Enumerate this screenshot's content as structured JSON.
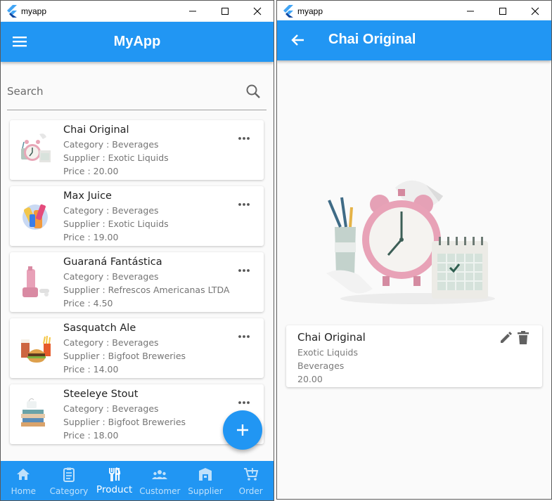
{
  "left_window": {
    "title": "myapp",
    "appbar_title": "MyApp",
    "search_placeholder": "Search",
    "products": [
      {
        "name": "Chai Original",
        "category": "Category : Beverages",
        "supplier": "Supplier : Exotic Liquids",
        "price": "Price : 20.00",
        "image": "alarm-clock-illustration"
      },
      {
        "name": "Max Juice",
        "category": "Category : Beverages",
        "supplier": "Supplier : Exotic Liquids",
        "price": "Price : 19.00",
        "image": "juice-bottles-illustration"
      },
      {
        "name": "Guaraná Fantástica",
        "category": "Category : Beverages",
        "supplier": "Supplier : Refrescos Americanas LTDA",
        "price": "Price : 4.50",
        "image": "pink-bottles-illustration"
      },
      {
        "name": "Sasquatch Ale",
        "category": "Category : Beverages",
        "supplier": "Supplier : Bigfoot Breweries",
        "price": "Price : 14.00",
        "image": "burger-drinks-illustration"
      },
      {
        "name": "Steeleye Stout",
        "category": "Category : Beverages",
        "supplier": "Supplier : Bigfoot Breweries",
        "price": "Price : 18.00",
        "image": "books-cup-illustration"
      }
    ],
    "bottom_nav": [
      {
        "label": "Home",
        "icon": "home-icon",
        "active": false
      },
      {
        "label": "Category",
        "icon": "clipboard-icon",
        "active": false
      },
      {
        "label": "Product",
        "icon": "cutlery-icon",
        "active": true
      },
      {
        "label": "Customer",
        "icon": "people-icon",
        "active": false
      },
      {
        "label": "Supplier",
        "icon": "store-icon",
        "active": false
      },
      {
        "label": "Order",
        "icon": "cart-icon",
        "active": false
      }
    ]
  },
  "right_window": {
    "title": "myapp",
    "appbar_title": "Chai Original",
    "product": {
      "name": "Chai Original",
      "supplier": "Exotic Liquids",
      "category": "Beverages",
      "price": "20.00",
      "image": "alarm-clock-illustration"
    }
  },
  "colors": {
    "primary": "#2196f3",
    "background": "#fafafa",
    "card": "#ffffff",
    "nav_inactive": "#bfe1fb"
  }
}
